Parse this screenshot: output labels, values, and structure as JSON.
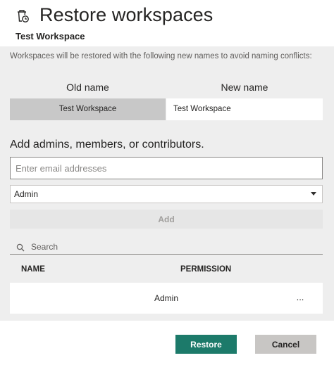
{
  "dialog": {
    "title": "Restore workspaces",
    "subtitle": "Test Workspace",
    "title_icon": "restore-trash-icon"
  },
  "notice": "Workspaces will be restored with the following new names to avoid naming conflicts:",
  "rename_table": {
    "old_header": "Old name",
    "new_header": "New name",
    "rows": [
      {
        "old": "Test Workspace",
        "new": "Test Workspace"
      }
    ]
  },
  "access": {
    "section_title": "Add admins, members, or contributors.",
    "email_placeholder": "Enter email addresses",
    "role_selected": "Admin",
    "add_label": "Add",
    "search_placeholder": "Search",
    "columns": {
      "name": "NAME",
      "permission": "PERMISSION"
    },
    "members": [
      {
        "name": "",
        "permission": "Admin",
        "more": "..."
      }
    ]
  },
  "footer": {
    "restore_label": "Restore",
    "cancel_label": "Cancel"
  },
  "colors": {
    "primary": "#1c7a6a",
    "panel_bg": "#eeeeee",
    "secondary_button": "#c8c6c4"
  }
}
